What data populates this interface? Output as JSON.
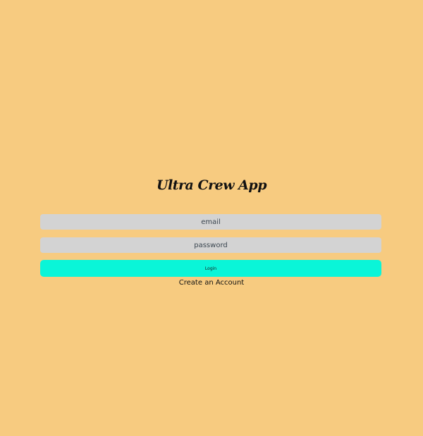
{
  "app": {
    "title": "Ultra Crew App"
  },
  "login_form": {
    "email": {
      "placeholder": "email",
      "value": ""
    },
    "password": {
      "placeholder": "password",
      "value": ""
    },
    "login_button_label": "Login",
    "create_account_label": "Create an Account"
  },
  "colors": {
    "background": "#F7CB80",
    "input_background": "#D3D3D3",
    "button_accent": "#0AF5D8"
  }
}
